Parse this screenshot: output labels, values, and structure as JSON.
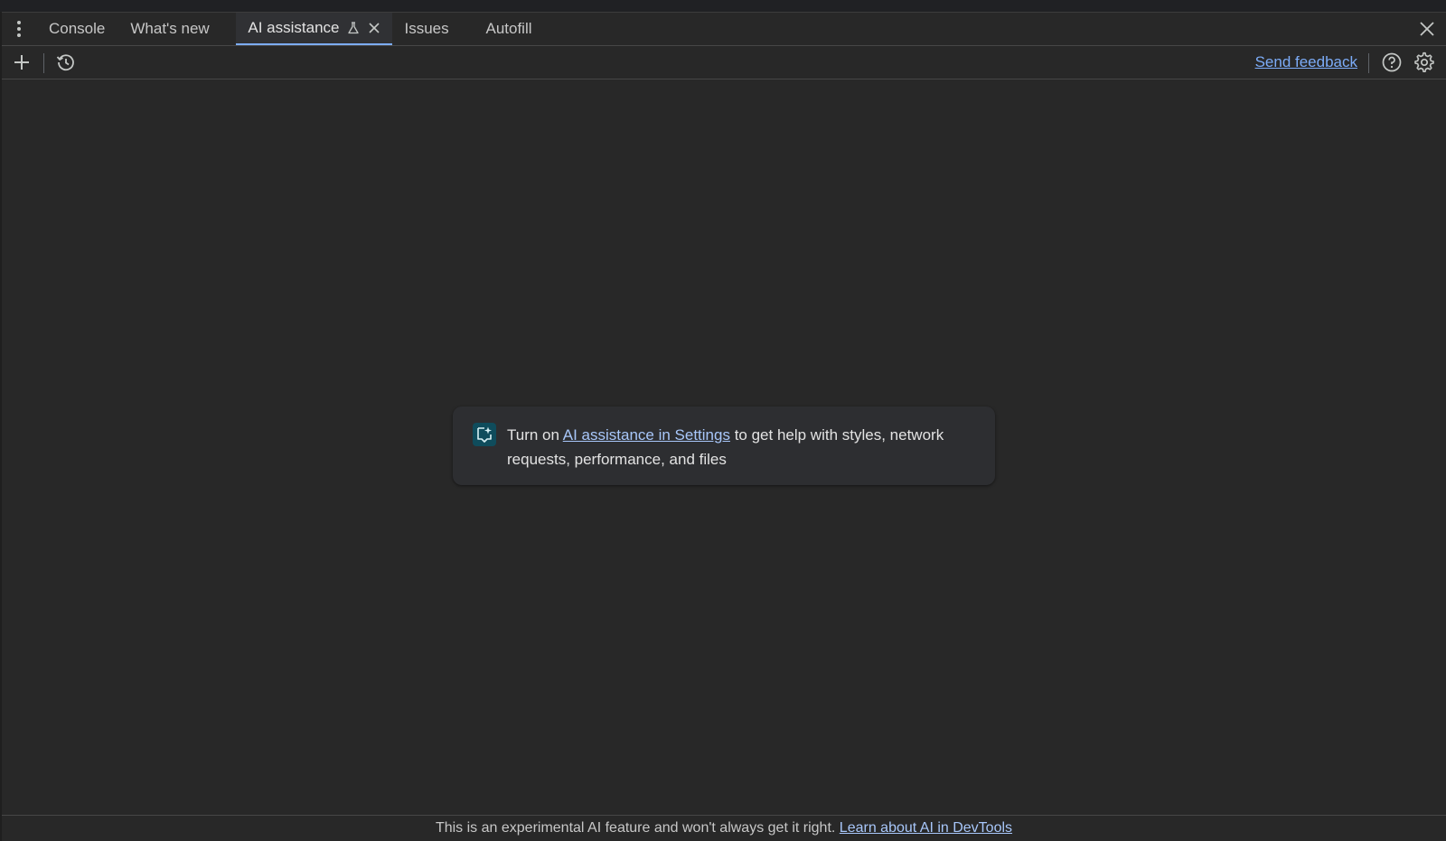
{
  "tabs": [
    {
      "label": "Console",
      "active": false
    },
    {
      "label": "What's new",
      "active": false
    },
    {
      "label": "AI assistance",
      "active": true
    },
    {
      "label": "Issues",
      "active": false
    },
    {
      "label": "Autofill",
      "active": false
    }
  ],
  "toolbar": {
    "new_chat_icon": "plus-icon",
    "history_icon": "history-icon",
    "send_feedback": "Send feedback",
    "help_icon": "help-icon",
    "settings_icon": "gear-icon"
  },
  "notice": {
    "prefix": "Turn on ",
    "link": "AI assistance in Settings",
    "suffix": " to get help with styles, network requests, performance, and files"
  },
  "footer": {
    "text": "This is an experimental AI feature and won't always get it right. ",
    "link": "Learn about AI in DevTools"
  },
  "colors": {
    "accent": "#7cacf8",
    "link": "#a8c7fa",
    "background": "#282828"
  }
}
